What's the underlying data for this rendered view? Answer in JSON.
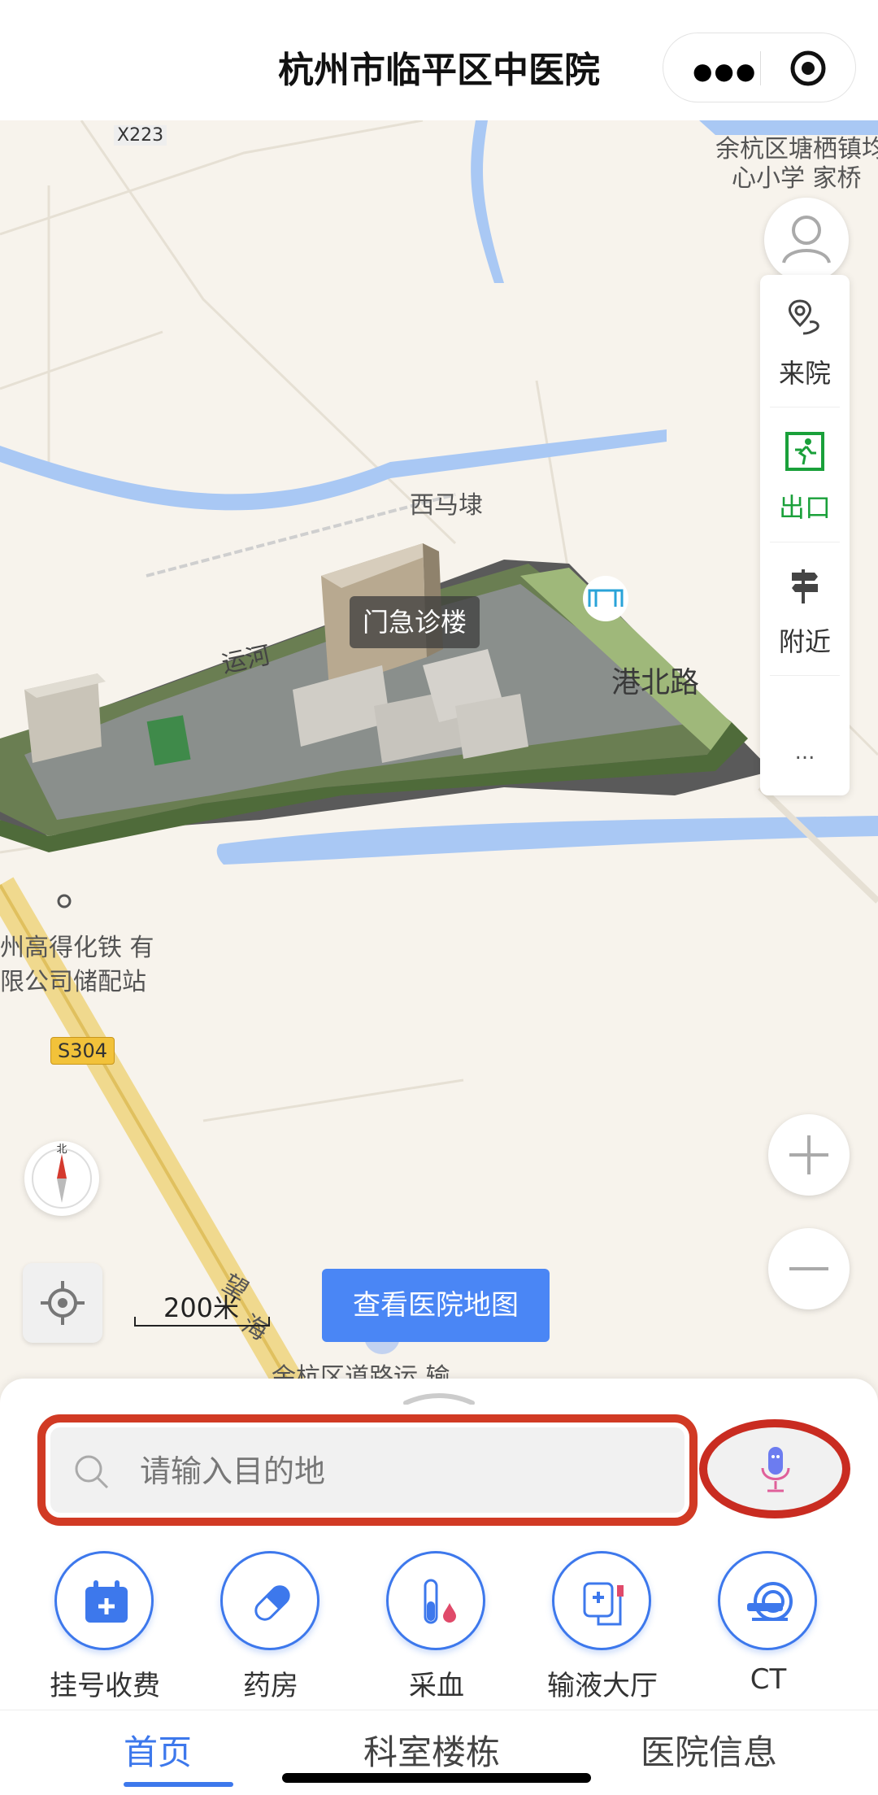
{
  "header": {
    "title": "杭州市临平区中医院",
    "more_icon": "more-dots-icon",
    "close_icon": "target-icon"
  },
  "map": {
    "labels": {
      "x223": "X223",
      "yuhang_north": "余杭区塘栖镇均",
      "yuhang_north2": "心小学 家桥",
      "ximadi": "西马埭",
      "gangbei_road": "港北路",
      "yunhe": "运河",
      "company1": "州高得化铁 有",
      "company2": "限公司储配站",
      "s304": "S304",
      "wang": "望",
      "hai": "海",
      "bottom_road": "余杭区道路运 输"
    },
    "building_label": "门急诊楼",
    "compass_label": "北",
    "scale_text": "200米",
    "view_map_button": "查看医院地图"
  },
  "side_panel": {
    "items": [
      {
        "label": "来院",
        "icon": "location-route-icon",
        "color": "#333333"
      },
      {
        "label": "出口",
        "icon": "exit-icon",
        "color": "#1aa03a"
      },
      {
        "label": "附近",
        "icon": "signpost-icon",
        "color": "#333333"
      }
    ],
    "more": "..."
  },
  "search": {
    "placeholder": "请输入目的地",
    "value": ""
  },
  "services": [
    {
      "label": "挂号收费",
      "icon": "calendar-plus-icon"
    },
    {
      "label": "药房",
      "icon": "pill-icon"
    },
    {
      "label": "采血",
      "icon": "blood-test-icon"
    },
    {
      "label": "输液大厅",
      "icon": "iv-drip-icon"
    },
    {
      "label": "CT",
      "icon": "ct-scanner-icon"
    }
  ],
  "tabs": [
    {
      "label": "首页",
      "active": true
    },
    {
      "label": "科室楼栋",
      "active": false
    },
    {
      "label": "医院信息",
      "active": false
    }
  ],
  "colors": {
    "accent": "#3d78ec",
    "highlight_red": "#d13a24",
    "exit_green": "#1aa03a"
  }
}
